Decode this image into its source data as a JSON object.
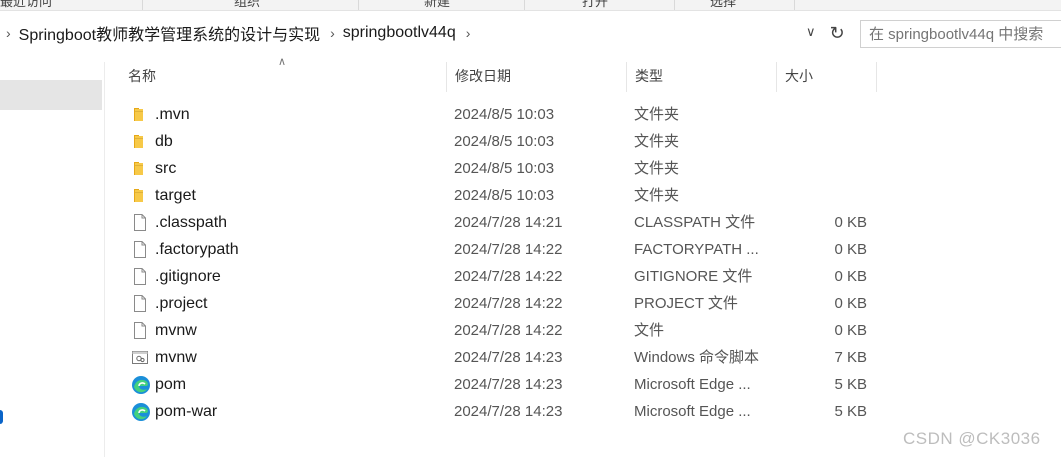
{
  "ribbon": {
    "labels": [
      "最近访问",
      "组织",
      "新建",
      "打开",
      "选择"
    ]
  },
  "address": {
    "crumbs": [
      "Springboot教师教学管理系统的设计与实现",
      "springbootlv44q"
    ]
  },
  "search": {
    "placeholder": "在 springbootlv44q 中搜索"
  },
  "columns": {
    "name": "名称",
    "date": "修改日期",
    "type": "类型",
    "size": "大小"
  },
  "files": [
    {
      "name": ".mvn",
      "date": "2024/8/5 10:03",
      "type": "文件夹",
      "size": "",
      "icon": "folder-icon"
    },
    {
      "name": "db",
      "date": "2024/8/5 10:03",
      "type": "文件夹",
      "size": "",
      "icon": "folder-icon"
    },
    {
      "name": "src",
      "date": "2024/8/5 10:03",
      "type": "文件夹",
      "size": "",
      "icon": "folder-icon"
    },
    {
      "name": "target",
      "date": "2024/8/5 10:03",
      "type": "文件夹",
      "size": "",
      "icon": "folder-icon"
    },
    {
      "name": ".classpath",
      "date": "2024/7/28 14:21",
      "type": "CLASSPATH 文件",
      "size": "0 KB",
      "icon": "file-icon"
    },
    {
      "name": ".factorypath",
      "date": "2024/7/28 14:22",
      "type": "FACTORYPATH ...",
      "size": "0 KB",
      "icon": "file-icon"
    },
    {
      "name": ".gitignore",
      "date": "2024/7/28 14:22",
      "type": "GITIGNORE 文件",
      "size": "0 KB",
      "icon": "file-icon"
    },
    {
      "name": ".project",
      "date": "2024/7/28 14:22",
      "type": "PROJECT 文件",
      "size": "0 KB",
      "icon": "file-icon"
    },
    {
      "name": "mvnw",
      "date": "2024/7/28 14:22",
      "type": "文件",
      "size": "0 KB",
      "icon": "file-icon"
    },
    {
      "name": "mvnw",
      "date": "2024/7/28 14:23",
      "type": "Windows 命令脚本",
      "size": "7 KB",
      "icon": "script-icon"
    },
    {
      "name": "pom",
      "date": "2024/7/28 14:23",
      "type": "Microsoft Edge ...",
      "size": "5 KB",
      "icon": "edge-icon"
    },
    {
      "name": "pom-war",
      "date": "2024/7/28 14:23",
      "type": "Microsoft Edge ...",
      "size": "5 KB",
      "icon": "edge-icon"
    }
  ],
  "watermark": "CSDN @CK3036"
}
